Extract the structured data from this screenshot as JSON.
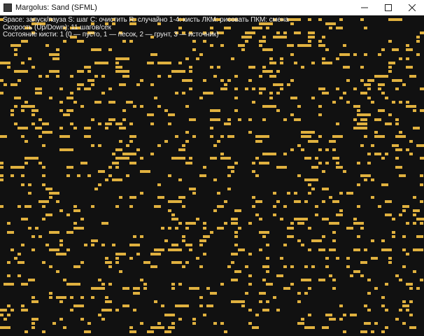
{
  "window": {
    "title": "Margolus: Sand (SFML)",
    "controls": {
      "minimize_icon": "minimize-icon",
      "maximize_icon": "maximize-icon",
      "close_icon": "close-icon"
    }
  },
  "hud": {
    "line1": "Space: запуск/пауза  S: шаг  C: очистить  R: случайно  1-4: кисть  ЛКМ: рисовать  ПКМ: смена",
    "line2": "Скорость (Up/Down): 11 шагов/сек",
    "line3": "Состояние кисти: 1 (0 — пусто, 1 — песок, 2 — грунт, 3 — источник)"
  },
  "colors": {
    "background": "#111111",
    "sand": "#e0b13f",
    "text": "#ededed",
    "titlebar": "#ffffff"
  },
  "simulation": {
    "brush_state": 1,
    "steps_per_second": 11,
    "fill_fraction": 0.11
  }
}
